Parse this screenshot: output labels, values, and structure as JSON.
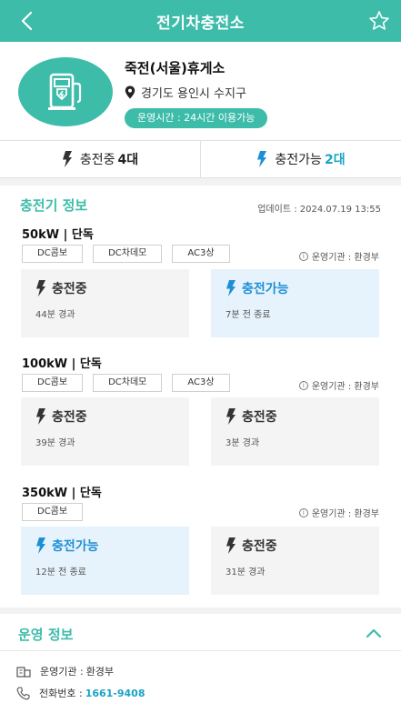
{
  "header": {
    "title": "전기차충전소"
  },
  "station": {
    "name": "죽전(서울)휴게소",
    "address": "경기도 용인시 수지구",
    "hours": "운영시간 : 24시간 이용가능"
  },
  "summary": {
    "charging_label": "충전중",
    "charging_count": "4대",
    "available_label": "충전가능",
    "available_count": "2대"
  },
  "charger_info": {
    "title": "충전기 정보",
    "updated": "업데이트 : 2024.07.19 13:55",
    "groups": [
      {
        "title": "50kW  |  단독",
        "tags": [
          "DC콤보",
          "DC차데모",
          "AC3상"
        ],
        "operator": "운영기관 : 환경부",
        "chargers": [
          {
            "status": "충전중",
            "detail": "44분 경과",
            "state": "busy"
          },
          {
            "status": "충전가능",
            "detail": "7분 전 종료",
            "state": "free"
          }
        ]
      },
      {
        "title": "100kW  |  단독",
        "tags": [
          "DC콤보",
          "DC차데모",
          "AC3상"
        ],
        "operator": "운영기관 : 환경부",
        "chargers": [
          {
            "status": "충전중",
            "detail": "39분 경과",
            "state": "busy"
          },
          {
            "status": "충전중",
            "detail": "3분 경과",
            "state": "busy"
          }
        ]
      },
      {
        "title": "350kW  |  단독",
        "tags": [
          "DC콤보"
        ],
        "operator": "운영기관 : 환경부",
        "chargers": [
          {
            "status": "충전가능",
            "detail": "12분 전 종료",
            "state": "free"
          },
          {
            "status": "충전중",
            "detail": "31분 경과",
            "state": "busy"
          }
        ]
      }
    ]
  },
  "operation": {
    "title": "운영 정보",
    "agency_label": "운영기관 :",
    "agency_value": "환경부",
    "phone_label": "전화번호 :",
    "phone_value": "1661-9408"
  },
  "colors": {
    "primary": "#3dbcaa",
    "available": "#1e8fd6",
    "available_bg": "#e6f3fc",
    "busy_bg": "#f4f4f4"
  }
}
